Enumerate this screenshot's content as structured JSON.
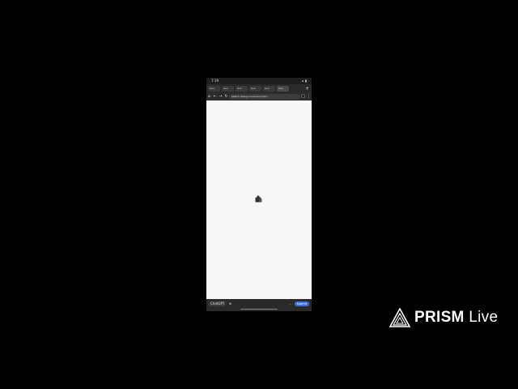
{
  "status_bar": {
    "time": "7:19",
    "icons": "⊿ ▮"
  },
  "tabs": [
    {
      "label": "Goo"
    },
    {
      "label": "Goo"
    },
    {
      "label": "Goo"
    },
    {
      "label": "Goo"
    },
    {
      "label": "Goo"
    },
    {
      "label": "Goo"
    }
  ],
  "toolbar": {
    "url": "sketch-data.js-mcp/?prompt=..."
  },
  "bottom_bar": {
    "left_label": "ChatGPT",
    "submit_label": "Submit"
  },
  "brand": {
    "strong": "PRISM",
    "light": "Live"
  },
  "colors": {
    "accent": "#3b6fe0",
    "page_bg": "#f8f7f5",
    "chrome": "#2b2b2b"
  }
}
